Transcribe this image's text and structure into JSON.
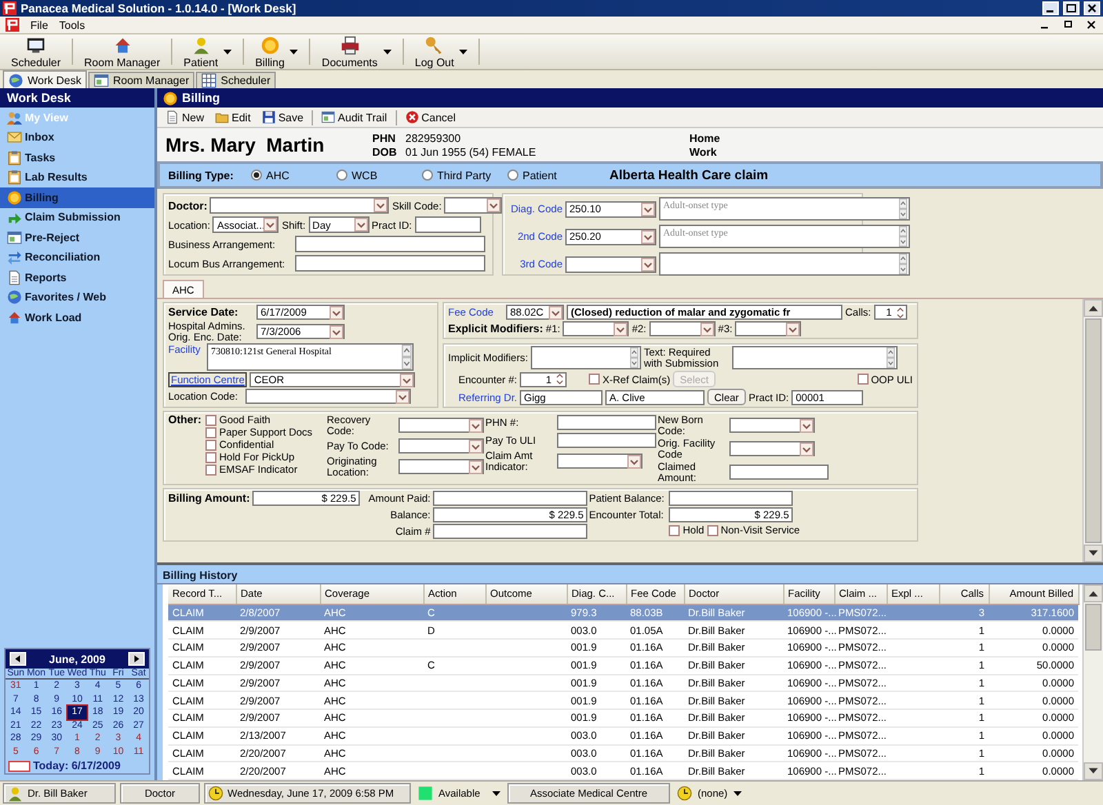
{
  "window": {
    "title": "Panacea Medical Solution - 1.0.14.0 - [Work Desk]"
  },
  "menu": [
    "File",
    "Tools"
  ],
  "toolbar": [
    {
      "label": "Scheduler",
      "dropdown": false
    },
    {
      "label": "Room Manager",
      "dropdown": false
    },
    {
      "label": "Patient",
      "dropdown": true
    },
    {
      "label": "Billing",
      "dropdown": true
    },
    {
      "label": "Documents",
      "dropdown": true
    },
    {
      "label": "Log Out",
      "dropdown": true
    }
  ],
  "tabs": [
    {
      "label": "Work Desk",
      "selected": true
    },
    {
      "label": "Room Manager",
      "selected": false
    },
    {
      "label": "Scheduler",
      "selected": false
    }
  ],
  "sidebar": {
    "title": "Work Desk",
    "items": [
      {
        "label": "My View",
        "kind": "header",
        "selected": false
      },
      {
        "label": "Inbox",
        "kind": "item",
        "selected": false
      },
      {
        "label": "Tasks",
        "kind": "item",
        "selected": false
      },
      {
        "label": "Lab Results",
        "kind": "item",
        "selected": false
      },
      {
        "label": "Billing",
        "kind": "item",
        "selected": true
      },
      {
        "label": "Claim Submission",
        "kind": "item",
        "selected": false
      },
      {
        "label": "Pre-Reject",
        "kind": "item",
        "selected": false
      },
      {
        "label": "Reconciliation",
        "kind": "item",
        "selected": false
      },
      {
        "label": "Reports",
        "kind": "item",
        "selected": false
      },
      {
        "label": "Favorites / Web",
        "kind": "item",
        "selected": false
      },
      {
        "label": "Work Load",
        "kind": "item",
        "selected": false
      }
    ]
  },
  "calendar": {
    "month": "June, 2009",
    "weekdays": [
      "Sun",
      "Mon",
      "Tue",
      "Wed",
      "Thu",
      "Fri",
      "Sat"
    ],
    "days": [
      {
        "label": "31",
        "other_month": true,
        "selected": false
      },
      {
        "label": "1",
        "other_month": false,
        "selected": false
      },
      {
        "label": "2",
        "other_month": false,
        "selected": false
      },
      {
        "label": "3",
        "other_month": false,
        "selected": false
      },
      {
        "label": "4",
        "other_month": false,
        "selected": false
      },
      {
        "label": "5",
        "other_month": false,
        "selected": false
      },
      {
        "label": "6",
        "other_month": false,
        "selected": false
      },
      {
        "label": "7",
        "other_month": false,
        "selected": false
      },
      {
        "label": "8",
        "other_month": false,
        "selected": false
      },
      {
        "label": "9",
        "other_month": false,
        "selected": false
      },
      {
        "label": "10",
        "other_month": false,
        "selected": false
      },
      {
        "label": "11",
        "other_month": false,
        "selected": false
      },
      {
        "label": "12",
        "other_month": false,
        "selected": false
      },
      {
        "label": "13",
        "other_month": false,
        "selected": false
      },
      {
        "label": "14",
        "other_month": false,
        "selected": false
      },
      {
        "label": "15",
        "other_month": false,
        "selected": false
      },
      {
        "label": "16",
        "other_month": false,
        "selected": false
      },
      {
        "label": "17",
        "other_month": false,
        "selected": true
      },
      {
        "label": "18",
        "other_month": false,
        "selected": false
      },
      {
        "label": "19",
        "other_month": false,
        "selected": false
      },
      {
        "label": "20",
        "other_month": false,
        "selected": false
      },
      {
        "label": "21",
        "other_month": false,
        "selected": false
      },
      {
        "label": "22",
        "other_month": false,
        "selected": false
      },
      {
        "label": "23",
        "other_month": false,
        "selected": false
      },
      {
        "label": "24",
        "other_month": false,
        "selected": false
      },
      {
        "label": "25",
        "other_month": false,
        "selected": false
      },
      {
        "label": "26",
        "other_month": false,
        "selected": false
      },
      {
        "label": "27",
        "other_month": false,
        "selected": false
      },
      {
        "label": "28",
        "other_month": false,
        "selected": false
      },
      {
        "label": "29",
        "other_month": false,
        "selected": false
      },
      {
        "label": "30",
        "other_month": false,
        "selected": false
      },
      {
        "label": "1",
        "other_month": true,
        "selected": false
      },
      {
        "label": "2",
        "other_month": true,
        "selected": false
      },
      {
        "label": "3",
        "other_month": true,
        "selected": false
      },
      {
        "label": "4",
        "other_month": true,
        "selected": false
      },
      {
        "label": "5",
        "other_month": true,
        "selected": false
      },
      {
        "label": "6",
        "other_month": true,
        "selected": false
      },
      {
        "label": "7",
        "other_month": true,
        "selected": false
      },
      {
        "label": "8",
        "other_month": true,
        "selected": false
      },
      {
        "label": "9",
        "other_month": true,
        "selected": false
      },
      {
        "label": "10",
        "other_month": true,
        "selected": false
      },
      {
        "label": "11",
        "other_month": true,
        "selected": false
      }
    ],
    "today": "Today: 6/17/2009"
  },
  "billing": {
    "title": "Billing",
    "actions": [
      "New",
      "Edit",
      "Save",
      "Audit Trail",
      "Cancel"
    ]
  },
  "patient": {
    "name": "Mrs. Mary  Martin",
    "phn_label": "PHN",
    "phn": "282959300",
    "dob_label": "DOB",
    "dob": "01 Jun 1955 (54) FEMALE",
    "contacts": [
      "Home",
      "Work"
    ]
  },
  "billing_type": {
    "label": "Billing Type:",
    "options": [
      {
        "label": "AHC",
        "selected": true
      },
      {
        "label": "WCB",
        "selected": false
      },
      {
        "label": "Third Party",
        "selected": false
      },
      {
        "label": "Patient",
        "selected": false
      }
    ],
    "description": "Alberta Health Care claim"
  },
  "doctor_panel": {
    "doctor": {
      "label": "Doctor:"
    },
    "skill_code": {
      "label": "Skill Code:"
    },
    "location": {
      "label": "Location:",
      "value": "Associat..."
    },
    "shift": {
      "label": "Shift:",
      "value": "Day"
    },
    "pract_id": {
      "label": "Pract ID:"
    },
    "business_arrangement": {
      "label": "Business Arrangement:"
    },
    "locum_bus_arrangement": {
      "label": "Locum Bus Arrangement:"
    }
  },
  "diagnosis": [
    {
      "label": "Diag. Code",
      "code": "250.10",
      "description": "Adult-onset type"
    },
    {
      "label": "2nd Code",
      "code": "250.20",
      "description": "Adult-onset type"
    },
    {
      "label": "3rd Code"
    }
  ],
  "claim_tabs": [
    {
      "label": "AHC",
      "selected": true
    }
  ],
  "service": {
    "service_date": {
      "label": "Service Date:",
      "value": "6/17/2009"
    },
    "orig_enc_date": {
      "label": "Hospital Admins. Orig. Enc. Date:",
      "value": "7/3/2006"
    },
    "facility": {
      "label": "Facility",
      "value": "730810:121st General Hospital"
    },
    "function_centre": {
      "label": "Function Centre",
      "value": "CEOR"
    },
    "location_code": {
      "label": "Location Code:"
    }
  },
  "fee": {
    "fee_code": {
      "label": "Fee Code",
      "value": "88.02C",
      "description": "(Closed) reduction of malar and zygomatic fr"
    },
    "calls": {
      "label": "Calls:",
      "value": "1"
    },
    "explicit_modifiers": {
      "label": "Explicit Modifiers:",
      "slots": [
        "#1:",
        "#2:",
        "#3:"
      ]
    }
  },
  "encounter": {
    "implicit_modifiers": {
      "label": "Implicit Modifiers:"
    },
    "text_required": {
      "label": "Text: Required with Submission"
    },
    "encounter_no": {
      "label": "Encounter #:",
      "value": "1"
    },
    "xref": {
      "label": "X-Ref Claim(s)",
      "checked": false
    },
    "select_button": {
      "label": "Select",
      "disabled": true
    },
    "oop_uli": {
      "label": "OOP ULI",
      "checked": false
    },
    "referring_dr": {
      "label": "Referring Dr.",
      "last_name": "Gigg",
      "first_name": "A. Clive"
    },
    "clear_button": "Clear",
    "pract_id": {
      "label": "Pract ID:",
      "value": "00001"
    }
  },
  "other": {
    "label": "Other:",
    "flags": [
      {
        "label": "Good Faith",
        "checked": false
      },
      {
        "label": "Paper Support Docs",
        "checked": false
      },
      {
        "label": "Confidential",
        "checked": false
      },
      {
        "label": "Hold For PickUp",
        "checked": false
      },
      {
        "label": "EMSAF Indicator",
        "checked": false
      }
    ],
    "fields": [
      {
        "label": "Recovery Code:",
        "kind": "combo"
      },
      {
        "label": "Pay To Code:",
        "kind": "combo"
      },
      {
        "label": "Originating Location:",
        "kind": "combo"
      },
      {
        "label": "PHN #:",
        "kind": "text"
      },
      {
        "label": "Pay To ULI",
        "kind": "text"
      },
      {
        "label": "Claim Amt Indicator:",
        "kind": "combo"
      },
      {
        "label": "New Born Code:",
        "kind": "combo"
      },
      {
        "label": "Orig. Facility Code",
        "kind": "combo"
      },
      {
        "label": "Claimed Amount:",
        "kind": "text"
      }
    ]
  },
  "amounts": {
    "billing_amount": {
      "label": "Billing Amount:",
      "value": "$ 229.5"
    },
    "amount_paid": {
      "label": "Amount Paid:"
    },
    "balance": {
      "label": "Balance:",
      "value": "$ 229.5"
    },
    "claim_no": {
      "label": "Claim #"
    },
    "patient_balance": {
      "label": "Patient Balance:"
    },
    "encounter_total": {
      "label": "Encounter Total:",
      "value": "$ 229.5"
    },
    "flags": [
      {
        "label": "Hold",
        "checked": false
      },
      {
        "label": "Non-Visit Service",
        "checked": false
      }
    ]
  },
  "history": {
    "title": "Billing History",
    "columns": [
      "Record T...",
      "Date",
      "Coverage",
      "Action",
      "Outcome",
      "Diag. C...",
      "Fee Code",
      "Doctor",
      "Facility",
      "Claim ...",
      "Expl ...",
      "Calls",
      "Amount Billed"
    ],
    "rows": [
      {
        "record_type": "CLAIM",
        "date": "2/8/2007",
        "coverage": "AHC",
        "action": "C",
        "diag": "979.3",
        "fee_code": "88.03B",
        "doctor": "Dr.Bill Baker",
        "facility": "106900 -...",
        "claim": "PMS072...",
        "calls": "3",
        "amount_billed": "317.1600",
        "selected": true
      },
      {
        "record_type": "CLAIM",
        "date": "2/9/2007",
        "coverage": "AHC",
        "action": "D",
        "diag": "003.0",
        "fee_code": "01.05A",
        "doctor": "Dr.Bill Baker",
        "facility": "106900 -...",
        "claim": "PMS072...",
        "calls": "1",
        "amount_billed": "0.0000",
        "selected": false
      },
      {
        "record_type": "CLAIM",
        "date": "2/9/2007",
        "coverage": "AHC",
        "diag": "001.9",
        "fee_code": "01.16A",
        "doctor": "Dr.Bill Baker",
        "facility": "106900 -...",
        "claim": "PMS072...",
        "calls": "1",
        "amount_billed": "0.0000",
        "selected": false
      },
      {
        "record_type": "CLAIM",
        "date": "2/9/2007",
        "coverage": "AHC",
        "action": "C",
        "diag": "001.9",
        "fee_code": "01.16A",
        "doctor": "Dr.Bill Baker",
        "facility": "106900 -...",
        "claim": "PMS072...",
        "calls": "1",
        "amount_billed": "50.0000",
        "selected": false
      },
      {
        "record_type": "CLAIM",
        "date": "2/9/2007",
        "coverage": "AHC",
        "diag": "001.9",
        "fee_code": "01.16A",
        "doctor": "Dr.Bill Baker",
        "facility": "106900 -...",
        "claim": "PMS072...",
        "calls": "1",
        "amount_billed": "0.0000",
        "selected": false
      },
      {
        "record_type": "CLAIM",
        "date": "2/9/2007",
        "coverage": "AHC",
        "diag": "001.9",
        "fee_code": "01.16A",
        "doctor": "Dr.Bill Baker",
        "facility": "106900 -...",
        "claim": "PMS072...",
        "calls": "1",
        "amount_billed": "0.0000",
        "selected": false
      },
      {
        "record_type": "CLAIM",
        "date": "2/9/2007",
        "coverage": "AHC",
        "diag": "001.9",
        "fee_code": "01.16A",
        "doctor": "Dr.Bill Baker",
        "facility": "106900 -...",
        "claim": "PMS072...",
        "calls": "1",
        "amount_billed": "0.0000",
        "selected": false
      },
      {
        "record_type": "CLAIM",
        "date": "2/13/2007",
        "coverage": "AHC",
        "diag": "003.0",
        "fee_code": "01.16A",
        "doctor": "Dr.Bill Baker",
        "facility": "106900 -...",
        "claim": "PMS072...",
        "calls": "1",
        "amount_billed": "0.0000",
        "selected": false
      },
      {
        "record_type": "CLAIM",
        "date": "2/20/2007",
        "coverage": "AHC",
        "diag": "003.0",
        "fee_code": "01.16A",
        "doctor": "Dr.Bill Baker",
        "facility": "106900 -...",
        "claim": "PMS072...",
        "calls": "1",
        "amount_billed": "0.0000",
        "selected": false
      },
      {
        "record_type": "CLAIM",
        "date": "2/20/2007",
        "coverage": "AHC",
        "diag": "003.0",
        "fee_code": "01.16A",
        "doctor": "Dr.Bill Baker",
        "facility": "106900 -...",
        "claim": "PMS072...",
        "calls": "1",
        "amount_billed": "0.0000",
        "selected": false
      }
    ]
  },
  "status_bar": {
    "user": "Dr. Bill Baker",
    "role": "Doctor",
    "datetime": "Wednesday, June 17, 2009 6:58 PM",
    "availability": "Available",
    "clinic": "Associate Medical Centre",
    "room": "(none)"
  }
}
